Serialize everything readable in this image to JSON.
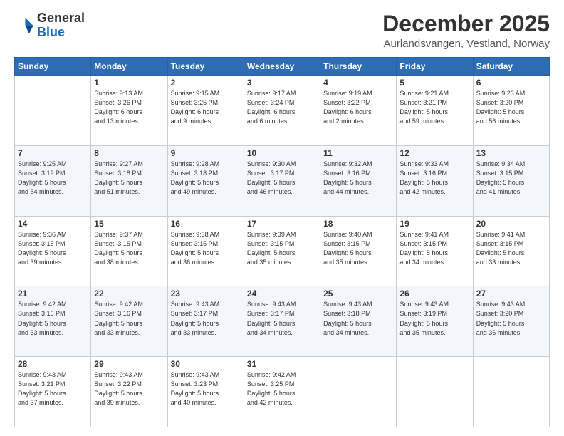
{
  "header": {
    "logo_general": "General",
    "logo_blue": "Blue",
    "month_title": "December 2025",
    "location": "Aurlandsvangen, Vestland, Norway"
  },
  "days_of_week": [
    "Sunday",
    "Monday",
    "Tuesday",
    "Wednesday",
    "Thursday",
    "Friday",
    "Saturday"
  ],
  "weeks": [
    [
      {
        "day": "",
        "info": ""
      },
      {
        "day": "1",
        "info": "Sunrise: 9:13 AM\nSunset: 3:26 PM\nDaylight: 6 hours\nand 13 minutes."
      },
      {
        "day": "2",
        "info": "Sunrise: 9:15 AM\nSunset: 3:25 PM\nDaylight: 6 hours\nand 9 minutes."
      },
      {
        "day": "3",
        "info": "Sunrise: 9:17 AM\nSunset: 3:24 PM\nDaylight: 6 hours\nand 6 minutes."
      },
      {
        "day": "4",
        "info": "Sunrise: 9:19 AM\nSunset: 3:22 PM\nDaylight: 6 hours\nand 2 minutes."
      },
      {
        "day": "5",
        "info": "Sunrise: 9:21 AM\nSunset: 3:21 PM\nDaylight: 5 hours\nand 59 minutes."
      },
      {
        "day": "6",
        "info": "Sunrise: 9:23 AM\nSunset: 3:20 PM\nDaylight: 5 hours\nand 56 minutes."
      }
    ],
    [
      {
        "day": "7",
        "info": "Sunrise: 9:25 AM\nSunset: 3:19 PM\nDaylight: 5 hours\nand 54 minutes."
      },
      {
        "day": "8",
        "info": "Sunrise: 9:27 AM\nSunset: 3:18 PM\nDaylight: 5 hours\nand 51 minutes."
      },
      {
        "day": "9",
        "info": "Sunrise: 9:28 AM\nSunset: 3:18 PM\nDaylight: 5 hours\nand 49 minutes."
      },
      {
        "day": "10",
        "info": "Sunrise: 9:30 AM\nSunset: 3:17 PM\nDaylight: 5 hours\nand 46 minutes."
      },
      {
        "day": "11",
        "info": "Sunrise: 9:32 AM\nSunset: 3:16 PM\nDaylight: 5 hours\nand 44 minutes."
      },
      {
        "day": "12",
        "info": "Sunrise: 9:33 AM\nSunset: 3:16 PM\nDaylight: 5 hours\nand 42 minutes."
      },
      {
        "day": "13",
        "info": "Sunrise: 9:34 AM\nSunset: 3:15 PM\nDaylight: 5 hours\nand 41 minutes."
      }
    ],
    [
      {
        "day": "14",
        "info": "Sunrise: 9:36 AM\nSunset: 3:15 PM\nDaylight: 5 hours\nand 39 minutes."
      },
      {
        "day": "15",
        "info": "Sunrise: 9:37 AM\nSunset: 3:15 PM\nDaylight: 5 hours\nand 38 minutes."
      },
      {
        "day": "16",
        "info": "Sunrise: 9:38 AM\nSunset: 3:15 PM\nDaylight: 5 hours\nand 36 minutes."
      },
      {
        "day": "17",
        "info": "Sunrise: 9:39 AM\nSunset: 3:15 PM\nDaylight: 5 hours\nand 35 minutes."
      },
      {
        "day": "18",
        "info": "Sunrise: 9:40 AM\nSunset: 3:15 PM\nDaylight: 5 hours\nand 35 minutes."
      },
      {
        "day": "19",
        "info": "Sunrise: 9:41 AM\nSunset: 3:15 PM\nDaylight: 5 hours\nand 34 minutes."
      },
      {
        "day": "20",
        "info": "Sunrise: 9:41 AM\nSunset: 3:15 PM\nDaylight: 5 hours\nand 33 minutes."
      }
    ],
    [
      {
        "day": "21",
        "info": "Sunrise: 9:42 AM\nSunset: 3:16 PM\nDaylight: 5 hours\nand 33 minutes."
      },
      {
        "day": "22",
        "info": "Sunrise: 9:42 AM\nSunset: 3:16 PM\nDaylight: 5 hours\nand 33 minutes."
      },
      {
        "day": "23",
        "info": "Sunrise: 9:43 AM\nSunset: 3:17 PM\nDaylight: 5 hours\nand 33 minutes."
      },
      {
        "day": "24",
        "info": "Sunrise: 9:43 AM\nSunset: 3:17 PM\nDaylight: 5 hours\nand 34 minutes."
      },
      {
        "day": "25",
        "info": "Sunrise: 9:43 AM\nSunset: 3:18 PM\nDaylight: 5 hours\nand 34 minutes."
      },
      {
        "day": "26",
        "info": "Sunrise: 9:43 AM\nSunset: 3:19 PM\nDaylight: 5 hours\nand 35 minutes."
      },
      {
        "day": "27",
        "info": "Sunrise: 9:43 AM\nSunset: 3:20 PM\nDaylight: 5 hours\nand 36 minutes."
      }
    ],
    [
      {
        "day": "28",
        "info": "Sunrise: 9:43 AM\nSunset: 3:21 PM\nDaylight: 5 hours\nand 37 minutes."
      },
      {
        "day": "29",
        "info": "Sunrise: 9:43 AM\nSunset: 3:22 PM\nDaylight: 5 hours\nand 39 minutes."
      },
      {
        "day": "30",
        "info": "Sunrise: 9:43 AM\nSunset: 3:23 PM\nDaylight: 5 hours\nand 40 minutes."
      },
      {
        "day": "31",
        "info": "Sunrise: 9:42 AM\nSunset: 3:25 PM\nDaylight: 5 hours\nand 42 minutes."
      },
      {
        "day": "",
        "info": ""
      },
      {
        "day": "",
        "info": ""
      },
      {
        "day": "",
        "info": ""
      }
    ]
  ]
}
